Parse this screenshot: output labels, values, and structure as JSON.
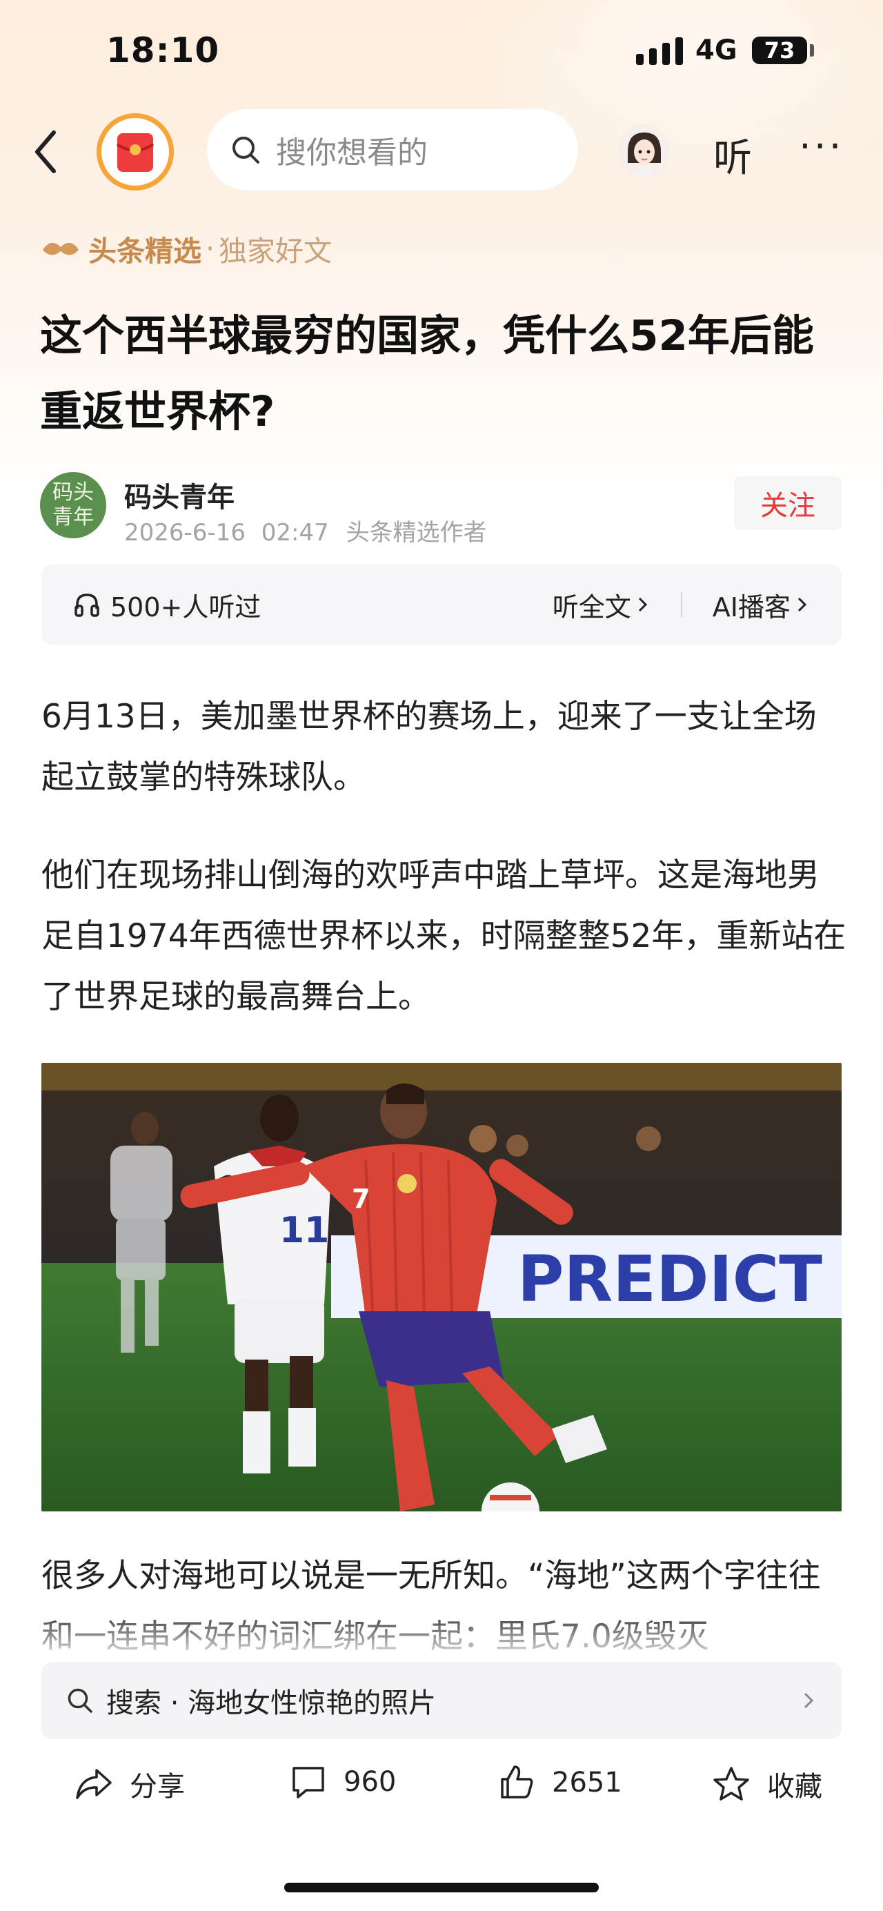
{
  "status_bar": {
    "time": "18:10",
    "network": "4G",
    "battery": "73"
  },
  "nav": {
    "back_icon": "chevron-left-icon",
    "redpack_icon": "red-envelope-icon",
    "search_placeholder": "搜你想看的",
    "listen_label": "听",
    "more_label": "···"
  },
  "channel": {
    "brand": "头条精选",
    "separator": "·",
    "sub": "独家好文"
  },
  "article": {
    "title": "这个西半球最穷的国家，凭什么52年后能重返世界杯?",
    "author": {
      "avatar_text_line1": "码头",
      "avatar_text_line2": "青年",
      "name": "码头青年",
      "date": "2026-6-16",
      "time": "02:47",
      "role": "头条精选作者",
      "follow_label": "关注"
    },
    "listen_bar": {
      "count": "500+人听过",
      "full_text": "听全文",
      "ai_podcast": "AI播客"
    },
    "paragraphs": [
      "6月13日，美加墨世界杯的赛场上，迎来了一支让全场起立鼓掌的特殊球队。",
      "他们在现场排山倒海的欢呼声中踏上草坪。这是海地男足自1974年西德世界杯以来，时隔整整52年，重新站在了世界足球的最高舞台上。",
      "很多人对海地可以说是一无所知。“海地”这两个字往往和一连串不好的词汇绑在一起：里氏7.0级毁灭"
    ],
    "image": {
      "banner_text": "PREDICT",
      "jersey_white": "11",
      "jersey_red": "7"
    }
  },
  "suggest": {
    "label": "搜索 · 海地女性惊艳的照片"
  },
  "actions": {
    "share": "分享",
    "comments": "960",
    "likes": "2651",
    "favorite": "收藏"
  },
  "colors": {
    "accent_red": "#e53a3a",
    "channel_gold": "#c88a4c",
    "redpack_ring": "#f7a43a"
  }
}
